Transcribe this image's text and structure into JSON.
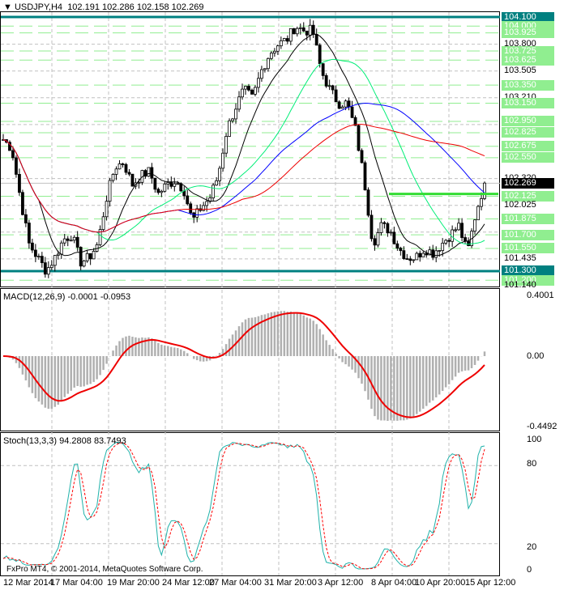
{
  "header": {
    "symbol": "USDJPY,H4",
    "open": "102.191",
    "high": "102.286",
    "low": "102.158",
    "close": "102.269"
  },
  "macd": {
    "label": "MACD(12,26,9)",
    "main": "-0.0001",
    "signal": "-0.0953",
    "scale": [
      "0.4001",
      "0.00",
      "-0.4492"
    ]
  },
  "stoch": {
    "label": "Stoch(13,3,3)",
    "main": "94.2808",
    "signal": "83.7493",
    "scale": [
      "100",
      "80",
      "20",
      "0"
    ]
  },
  "copyright": "FxPro MT4, © 2001-2014, MetaQuotes Software Corp.",
  "price_axis": [
    {
      "v": "104.100",
      "k": "t",
      "p": 104.1
    },
    {
      "v": "104.000",
      "k": "g",
      "p": 104.0
    },
    {
      "v": "103.925",
      "k": "g",
      "p": 103.925
    },
    {
      "v": "103.800",
      "k": "n",
      "p": 103.8
    },
    {
      "v": "103.725",
      "k": "g",
      "p": 103.725
    },
    {
      "v": "103.625",
      "k": "g",
      "p": 103.625
    },
    {
      "v": "103.505",
      "k": "n",
      "p": 103.505
    },
    {
      "v": "103.350",
      "k": "g",
      "p": 103.35
    },
    {
      "v": "103.210",
      "k": "n",
      "p": 103.21
    },
    {
      "v": "103.150",
      "k": "g",
      "p": 103.15
    },
    {
      "v": "102.950",
      "k": "g",
      "p": 102.95
    },
    {
      "v": "102.825",
      "k": "g",
      "p": 102.825
    },
    {
      "v": "102.675",
      "k": "g",
      "p": 102.675
    },
    {
      "v": "102.550",
      "k": "g",
      "p": 102.55
    },
    {
      "v": "102.320",
      "k": "n",
      "p": 102.32
    },
    {
      "v": "102.269",
      "k": "k",
      "p": 102.269
    },
    {
      "v": "102.125",
      "k": "g",
      "p": 102.125
    },
    {
      "v": "102.025",
      "k": "n",
      "p": 102.025
    },
    {
      "v": "101.875",
      "k": "g",
      "p": 101.875
    },
    {
      "v": "101.700",
      "k": "g",
      "p": 101.7
    },
    {
      "v": "101.550",
      "k": "g",
      "p": 101.55
    },
    {
      "v": "101.435",
      "k": "n",
      "p": 101.435
    },
    {
      "v": "101.300",
      "k": "t",
      "p": 101.3
    },
    {
      "v": "101.200",
      "k": "g",
      "p": 101.2
    },
    {
      "v": "101.140",
      "k": "n",
      "p": 101.14
    }
  ],
  "time_axis": [
    "12 Mar 2014",
    "17 Mar 04:00",
    "19 Mar 20:00",
    "24 Mar 12:00",
    "27 Mar 04:00",
    "31 Mar 20:00",
    "3 Apr 12:00",
    "8 Apr 04:00",
    "10 Apr 20:00",
    "15 Apr 12:00"
  ],
  "chart_data": {
    "type": "candlestick",
    "closes": [
      102.75,
      102.65,
      102.1,
      101.6,
      101.45,
      101.3,
      101.45,
      101.65,
      101.7,
      101.4,
      101.45,
      101.6,
      102.1,
      102.45,
      102.5,
      102.25,
      102.35,
      102.4,
      102.15,
      102.25,
      102.3,
      102.2,
      101.85,
      102.0,
      102.1,
      102.35,
      102.85,
      103.1,
      103.3,
      103.2,
      103.5,
      103.7,
      103.8,
      103.85,
      104.0,
      103.95,
      103.95,
      103.5,
      103.3,
      103.15,
      103.15,
      102.85,
      102.3,
      101.6,
      101.8,
      101.75,
      101.55,
      101.45,
      101.45,
      101.55,
      101.5,
      101.6,
      101.7,
      101.8,
      101.5,
      101.95,
      102.27
    ],
    "support_resistance": [
      104.1,
      101.3
    ],
    "trend_level": 102.15,
    "colors": {
      "ma_fast": "#000000",
      "ma_mid": "#00ee77",
      "ma_slow": "#0000ff",
      "ma_long": "#ee0000",
      "level": "#008080",
      "signal": "#ee0000",
      "hist": "#b0b0b0"
    }
  }
}
